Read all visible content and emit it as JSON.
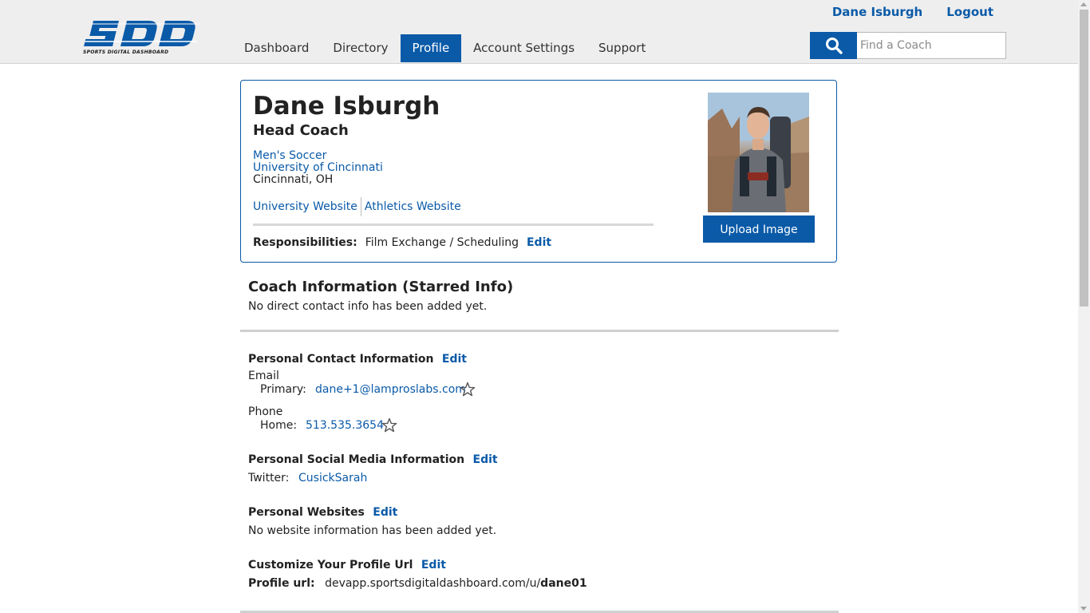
{
  "brand": {
    "logo_text": "SDD",
    "tagline": "SPORTS DIGITAL DASHBOARD",
    "color": "#0a5aa8"
  },
  "nav": {
    "items": [
      "Dashboard",
      "Directory",
      "Profile",
      "Account Settings",
      "Support"
    ],
    "active": "Profile"
  },
  "user": {
    "name": "Dane Isburgh",
    "logout": "Logout"
  },
  "search": {
    "icon": "search-icon",
    "placeholder": "Find a Coach"
  },
  "profile": {
    "name": "Dane Isburgh",
    "title": "Head Coach",
    "sport": "Men's Soccer",
    "school": "University of Cincinnati",
    "city": "Cincinnati, OH",
    "links": [
      "University Website",
      "Athletics Website"
    ],
    "responsibilities_label": "Responsibilities:",
    "responsibilities": "Film Exchange / Scheduling",
    "edit": "Edit",
    "upload_label": "Upload Image"
  },
  "coach_info": {
    "heading": "Coach Information (Starred Info)",
    "empty": "No direct contact info has been added yet."
  },
  "personal_contact": {
    "heading": "Personal Contact Information",
    "edit": "Edit",
    "email_label": "Email",
    "email_type": "Primary:",
    "email": "dane+1@lamproslabs.com",
    "phone_label": "Phone",
    "phone_type": "Home:",
    "phone": "513.535.3654"
  },
  "social": {
    "heading": "Personal Social Media Information",
    "edit": "Edit",
    "twitter_label": "Twitter:",
    "twitter": "CusickSarah"
  },
  "websites": {
    "heading": "Personal Websites",
    "edit": "Edit",
    "empty": "No website information has been added yet."
  },
  "profile_url": {
    "heading": "Customize Your Profile Url",
    "edit": "Edit",
    "label": "Profile url:",
    "base": "devapp.sportsdigitaldashboard.com/u/",
    "slug": "dane01"
  }
}
